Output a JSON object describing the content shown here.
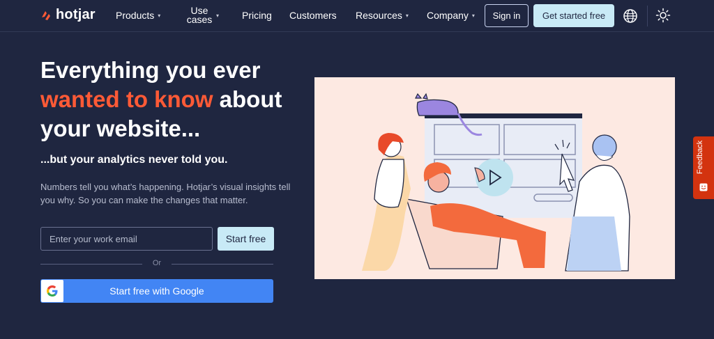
{
  "nav": {
    "logo_text": "hotjar",
    "items": [
      {
        "label": "Products",
        "caret": true
      },
      {
        "label": "Use cases",
        "caret": true
      },
      {
        "label": "Pricing",
        "caret": false
      },
      {
        "label": "Customers",
        "caret": false
      },
      {
        "label": "Resources",
        "caret": true
      },
      {
        "label": "Company",
        "caret": true
      }
    ],
    "sign_in": "Sign in",
    "get_started": "Get started free",
    "globe_icon": "globe-icon",
    "theme_icon": "sun-icon"
  },
  "hero": {
    "headline_line1": "Everything you ever",
    "headline_accent": "wanted to know",
    "headline_after_accent": " about",
    "headline_line3": "your website...",
    "subheadline": "...but your analytics never told you.",
    "description": "Numbers tell you what’s happening. Hotjar’s visual insights tell you why. So you can make the changes that matter.",
    "email_placeholder": "Enter your work email",
    "email_value": "",
    "start_free": "Start free",
    "or": "Or",
    "google_button": "Start free with Google"
  },
  "feedback": {
    "label": "Feedback"
  },
  "colors": {
    "background": "#1f2640",
    "accent": "#ff5a36",
    "cta": "#c8eaf6",
    "google": "#4285f4",
    "feedback": "#d3330f",
    "illustration_bg": "#fde9e2"
  }
}
